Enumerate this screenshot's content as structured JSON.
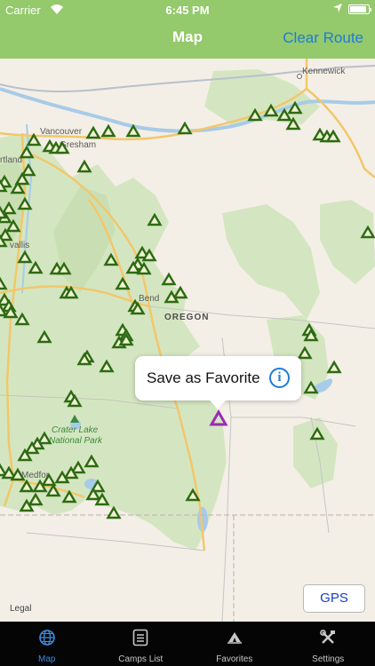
{
  "status_bar": {
    "carrier": "Carrier",
    "time": "6:45 PM",
    "battery_level": 0.9
  },
  "nav": {
    "title": "Map",
    "action": "Clear Route"
  },
  "map": {
    "city_labels": [
      "Kennewick",
      "Vancouver",
      "Gresham",
      "rtland",
      "vallis",
      "Bend",
      "Medfor"
    ],
    "state_label": "OREGON",
    "park_label_line1": "Crater Lake",
    "park_label_line2": "National Park",
    "legal": "Legal"
  },
  "callout": {
    "text": "Save as Favorite",
    "info_symbol": "i"
  },
  "gps_button": "GPS",
  "tabs": [
    {
      "label": "Map",
      "icon": "globe-icon",
      "active": true
    },
    {
      "label": "Camps List",
      "icon": "list-icon",
      "active": false
    },
    {
      "label": "Favorites",
      "icon": "camp-icon",
      "active": false
    },
    {
      "label": "Settings",
      "icon": "tools-icon",
      "active": false
    }
  ],
  "colors": {
    "nav_bg": "#94c96c",
    "accent": "#1f7bd8",
    "marker": "#2d6a12",
    "selected_marker": "#9a2bb3",
    "tabbar_bg": "#050505"
  }
}
